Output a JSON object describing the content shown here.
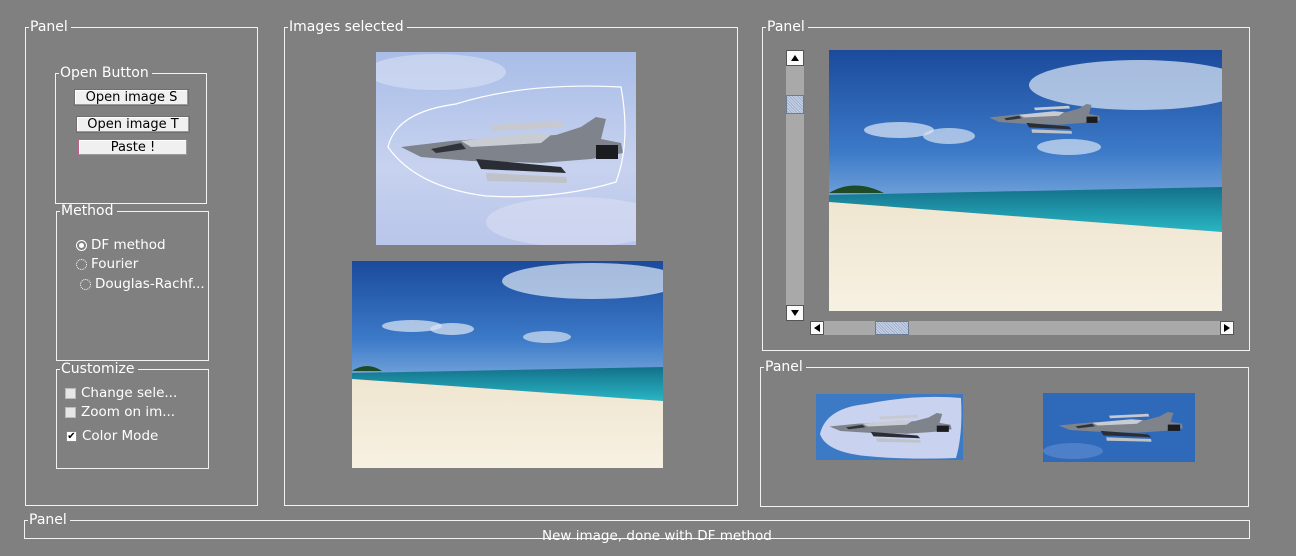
{
  "left_panel": {
    "title": "Panel"
  },
  "open_group": {
    "title": "Open Button",
    "open_s": "Open image S",
    "open_t": "Open image T",
    "paste": "Paste !"
  },
  "method_group": {
    "title": "Method",
    "options": [
      "DF method",
      "Fourier",
      "Douglas-Rachf..."
    ],
    "selected": "DF method"
  },
  "customize_group": {
    "title": "Customize",
    "options": [
      {
        "label": "Change sele...",
        "checked": false
      },
      {
        "label": "Zoom on im...",
        "checked": false
      },
      {
        "label": "Color Mode",
        "checked": true
      }
    ]
  },
  "images_panel": {
    "title": "Images selected"
  },
  "view_panel": {
    "title": "Panel"
  },
  "thumbs_panel": {
    "title": "Panel"
  },
  "status_panel": {
    "title": "Panel",
    "message": "New image, done with DF method"
  },
  "colors": {
    "background": "#808080",
    "border": "#f2f2f2",
    "sky_top": "#1d4fa3",
    "sea": "#1aa0b0",
    "sand": "#f1e8d2"
  }
}
